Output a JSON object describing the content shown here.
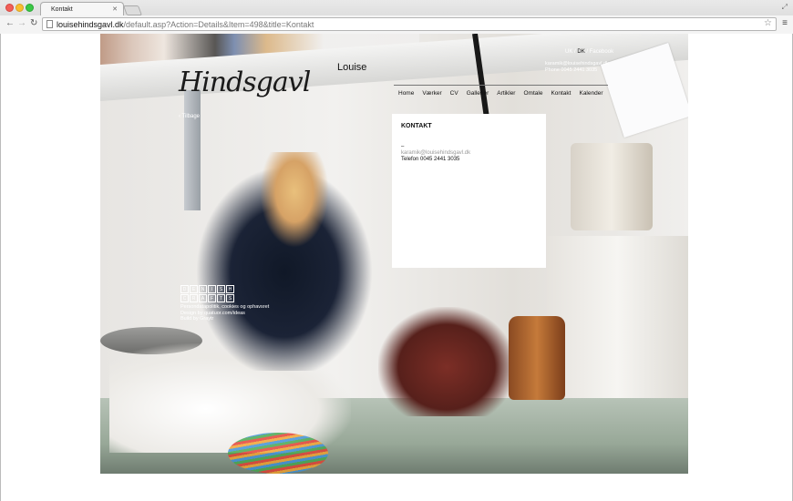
{
  "browser": {
    "tab_title": "Kontakt",
    "url_host": "louisehindsgavl.dk",
    "url_path": "/default.asp?Action=Details&Item=498&title=Kontakt"
  },
  "site": {
    "logo_first": "Louise",
    "logo_last": "Hindsgavl",
    "lang_uk": "UK",
    "lang_dk": "DK",
    "facebook": "Facebook",
    "email": "karamik@louisehindsgavl.dk",
    "phone_header": "Phone 0045 2441 3035",
    "back": "‹ Tilbage",
    "nav": [
      "Home",
      "Værker",
      "CV",
      "Gallerier",
      "Artikler",
      "Omtale",
      "Kontakt",
      "Kalender"
    ]
  },
  "panel": {
    "title": "KONTAKT",
    "dash": "–",
    "email": "karamik@louisehindsgavl.dk",
    "phone": "Telefon 0045 2441 3035"
  },
  "footer": {
    "badge_line1": [
      "D",
      "E",
      "N",
      "I",
      "S",
      "H"
    ],
    "badge_line2": [
      "C",
      "R",
      "A",
      "F",
      "T",
      "S"
    ],
    "line1": "Persondatapolitik, cookies og ophavsret",
    "line2": "Design by quatuor.com/ideas",
    "line3": "Build by Graytr"
  }
}
